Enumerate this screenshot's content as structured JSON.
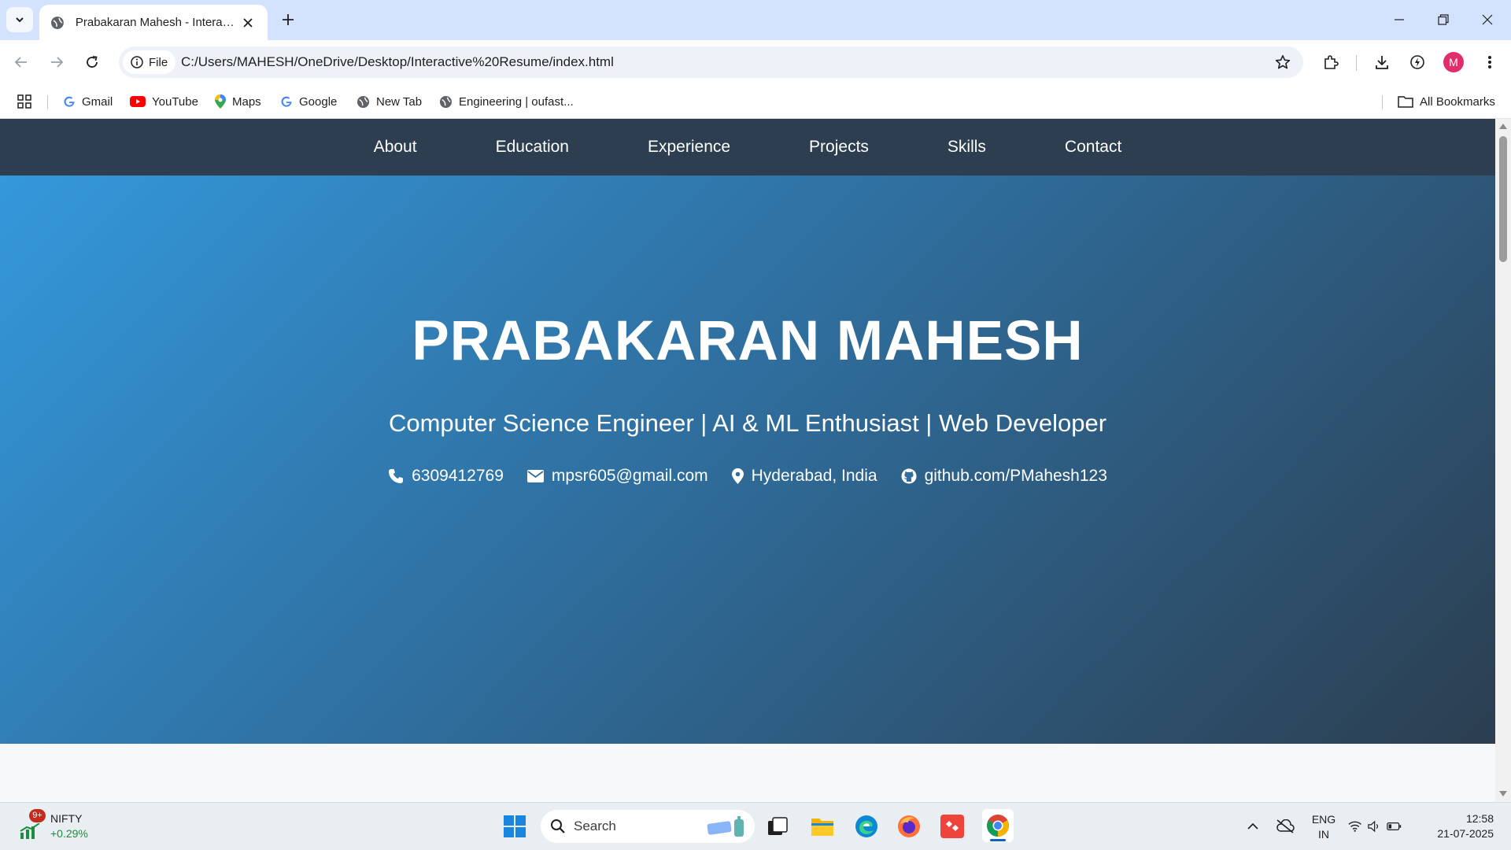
{
  "browser": {
    "tab_title": "Prabakaran Mahesh - Interactive Resume",
    "url_scheme_label": "File",
    "url": "C:/Users/MAHESH/OneDrive/Desktop/Interactive%20Resume/index.html",
    "profile_initial": "M",
    "bookmarks": [
      {
        "label": "Gmail",
        "icon": "google-icon"
      },
      {
        "label": "YouTube",
        "icon": "youtube-icon"
      },
      {
        "label": "Maps",
        "icon": "maps-icon"
      },
      {
        "label": "Google",
        "icon": "google-icon"
      },
      {
        "label": "New Tab",
        "icon": "globe-icon"
      },
      {
        "label": "Engineering | oufast...",
        "icon": "globe-icon"
      }
    ],
    "all_bookmarks": "All Bookmarks"
  },
  "site": {
    "nav": [
      "About",
      "Education",
      "Experience",
      "Projects",
      "Skills",
      "Contact"
    ],
    "name": "PRABAKARAN MAHESH",
    "tagline": "Computer Science Engineer | AI & ML Enthusiast | Web Developer",
    "contacts": {
      "phone": "6309412769",
      "email": "mpsr605@gmail.com",
      "location": "Hyderabad, India",
      "github": "github.com/PMahesh123"
    },
    "colors": {
      "nav_bg": "#2c3e50",
      "hero_start": "#3498db",
      "hero_end": "#2c3e50"
    }
  },
  "taskbar": {
    "widget_badge": "9+",
    "widget_name": "NIFTY",
    "widget_change": "+0.29%",
    "search_placeholder": "Search",
    "lang_line1": "ENG",
    "lang_line2": "IN",
    "time": "12:58",
    "date": "21-07-2025"
  }
}
